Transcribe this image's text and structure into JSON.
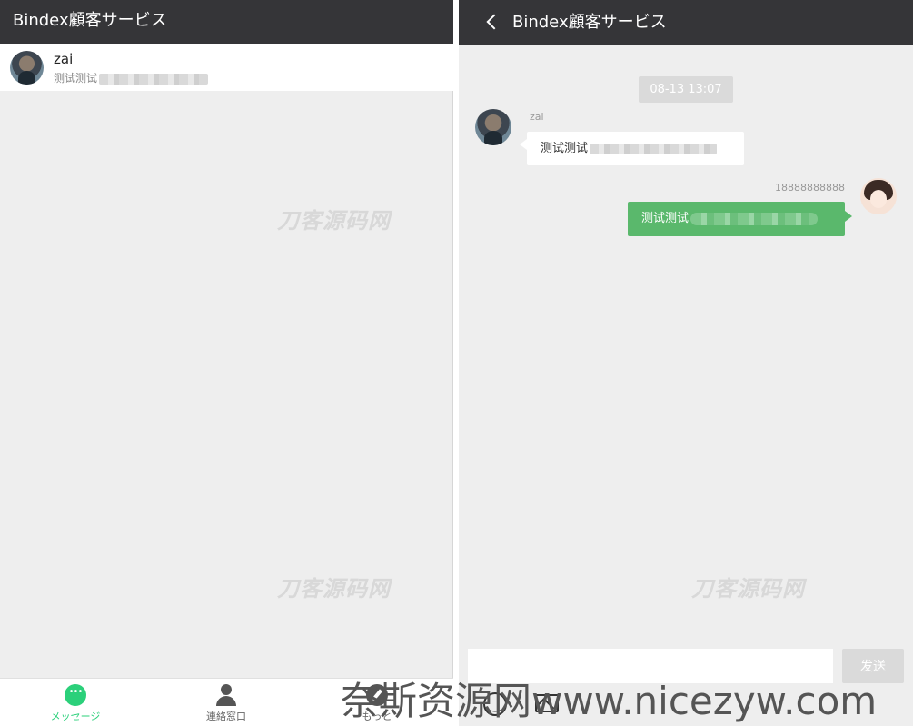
{
  "left": {
    "header_title": "Bindex顧客サービス",
    "conversation": {
      "name": "zai",
      "preview": "测试测试"
    },
    "watermark_1": "刀客源码网",
    "watermark_2": "刀客源码网",
    "nav": [
      {
        "label": "メッセージ",
        "icon": "message-icon",
        "active": true
      },
      {
        "label": "連絡窓口",
        "icon": "person-icon",
        "active": false
      },
      {
        "label": "もっと",
        "icon": "compass-icon",
        "active": false
      }
    ]
  },
  "right": {
    "header_title": "Bindex顧客サービス",
    "time": "08-13 13:07",
    "incoming": {
      "sender": "zai",
      "text": "测试测试"
    },
    "outgoing": {
      "sender": "18888888888",
      "text": "测试测试"
    },
    "watermark": "刀客源码网",
    "send_label": "发送",
    "input_value": ""
  },
  "footer_watermark": "奈斯资源网www.nicezyw.com",
  "colors": {
    "header_bg": "#353538",
    "accent_green": "#2bd07a",
    "bubble_out": "#5ab86c",
    "background": "#eeeeee"
  }
}
